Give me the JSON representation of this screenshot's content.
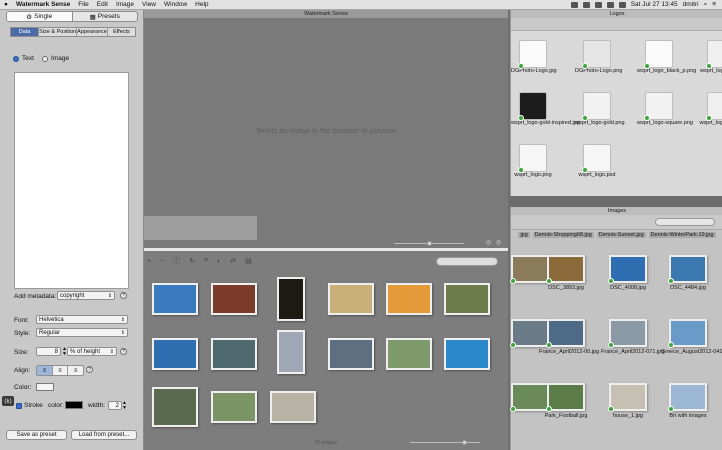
{
  "menubar": {
    "app": "Watermark Sense",
    "items": [
      "File",
      "Edit",
      "Image",
      "View",
      "Window",
      "Help"
    ],
    "clock": "Sat Jul 27  13:45",
    "user": "dmitri"
  },
  "window_title": "Watermark Sense",
  "mode_tabs": [
    {
      "label": "Single",
      "icon": "gear-icon"
    },
    {
      "label": "Presets",
      "icon": "grid-icon"
    }
  ],
  "settings_tabs": [
    "Data",
    "Size & Position",
    "Appearance",
    "Effects"
  ],
  "source": {
    "text": "Text",
    "image": "Image"
  },
  "metadata": {
    "label": "Add metadata:",
    "value": "copyright"
  },
  "font": {
    "label": "Font:",
    "value": "Helvetica"
  },
  "style": {
    "label": "Style:",
    "value": "Regular"
  },
  "size": {
    "label": "Size:",
    "value": "8",
    "unit": "% of height"
  },
  "align": {
    "label": "Align:"
  },
  "color": {
    "label": "Color:",
    "value": "#f4f4f4"
  },
  "stroke": {
    "label": "Stroke",
    "color_label": "color:",
    "color": "#000000",
    "width_label": "width:",
    "width": "2"
  },
  "buttons": {
    "save": "Save as preset",
    "load": "Load from preset..."
  },
  "preview_message": "Select an image in the browser to preview",
  "toolbar_icons": [
    "plus-icon",
    "minus-icon",
    "info-icon",
    "rotate-icon",
    "crop-icon",
    "adjust-icon",
    "flip-icon",
    "layers-icon"
  ],
  "image_count": "15 images",
  "photos": [
    {
      "color": "#3a7bbf"
    },
    {
      "color": "#7a3b2a"
    },
    {
      "color": "#1d1a14"
    },
    {
      "color": "#c9b07a"
    },
    {
      "color": "#e49a39"
    },
    {
      "color": "#6d7c4a"
    },
    {
      "color": "#2f6eb0"
    },
    {
      "color": "#4e6a6e"
    },
    {
      "color": "#a0a7b4"
    },
    {
      "color": "#5d6f80"
    },
    {
      "color": "#7f9a6a"
    },
    {
      "color": "#2a88c8"
    },
    {
      "color": "#5a6a4e"
    },
    {
      "color": "#7a9466"
    },
    {
      "color": "#b8b2a4"
    }
  ],
  "logos_window": {
    "title": "Logos",
    "files": [
      {
        "name": "DGPhoto-Logo.jpg",
        "color": "#fafafa"
      },
      {
        "name": "DGPhoto-Logo.png",
        "color": "#e6e6e6"
      },
      {
        "name": "wsprt_logo_black_p.png",
        "color": "#fafafa"
      },
      {
        "name": "wsprt_logo_f.png",
        "color": "#f0f0f0"
      },
      {
        "name": "wsprt_logo-gold-inspired.jpg",
        "color": "#1c1c1c"
      },
      {
        "name": "wsprt_logo-gold.png",
        "color": "#f2f2f2"
      },
      {
        "name": "wsprt_logo-square.png",
        "color": "#f2f2f2"
      },
      {
        "name": "wsprt_logo_s.png",
        "color": "#f0f0f0"
      },
      {
        "name": "wsprt_logo.png",
        "color": "#f6f6f6"
      },
      {
        "name": "wsprt_logo.psd",
        "color": "#f6f6f6"
      }
    ]
  },
  "images_window": {
    "title": "Images",
    "top_names": [
      "jpg",
      "Dennis-Shopping68.jpg",
      "Dennis-Sunset.jpg",
      "Dennis-WinterPark-19.jpg"
    ],
    "files": [
      {
        "name": "",
        "color": "#8a7b5a"
      },
      {
        "name": "DSC_3893.jpg",
        "color": "#8a6a3a"
      },
      {
        "name": "DSC_4008.jpg",
        "color": "#2f6eb0"
      },
      {
        "name": "DSC_4484.jpg",
        "color": "#3c78b0"
      },
      {
        "name": "",
        "color": "#6a7a86"
      },
      {
        "name": "France_April2012-00.jpg",
        "color": "#4d6a86"
      },
      {
        "name": "France_April2012-071.jpg",
        "color": "#8a9aa6"
      },
      {
        "name": "Greece_August2012-041.jpg",
        "color": "#6a9ac8"
      },
      {
        "name": "",
        "color": "#6a8a5a"
      },
      {
        "name": "Park_Football.jpg",
        "color": "#5c7d4a"
      },
      {
        "name": "house_1.jpg",
        "color": "#c6c0b2"
      },
      {
        "name": "Bri with images",
        "color": "#9bb7d4"
      }
    ]
  }
}
